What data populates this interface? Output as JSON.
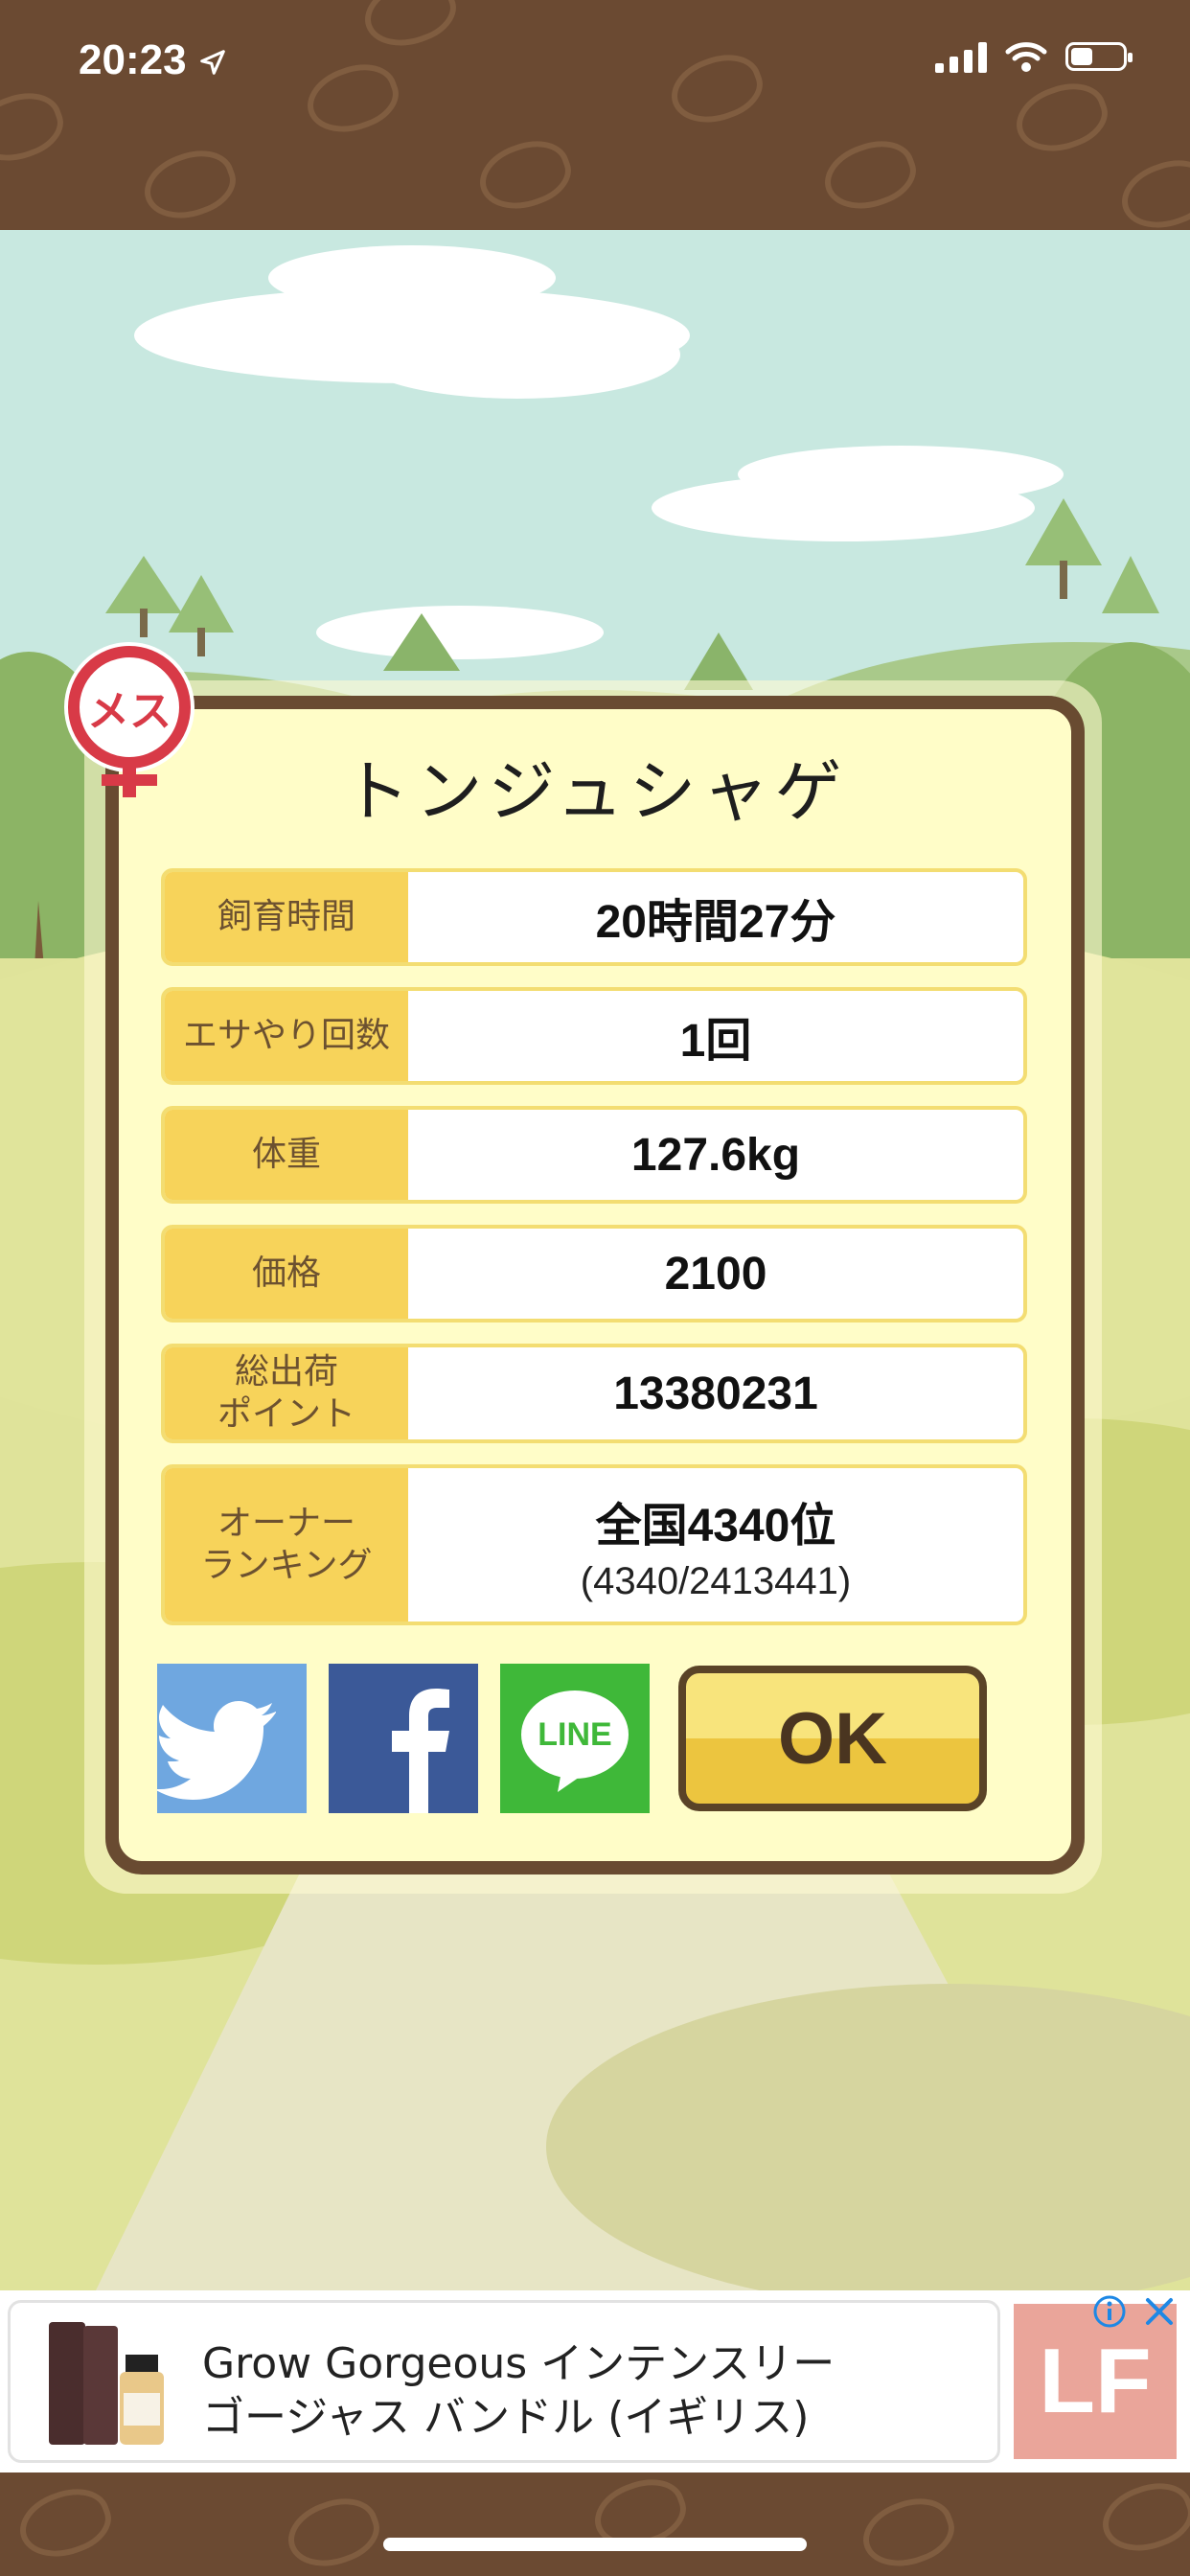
{
  "status_bar": {
    "time": "20:23",
    "icons": [
      "location-arrow-icon",
      "signal-icon",
      "wifi-icon",
      "battery-icon"
    ]
  },
  "gender_badge": {
    "text": "メス",
    "icon": "female-symbol-icon",
    "color": "#d83a47"
  },
  "pig": {
    "name": "トンジュシャゲ"
  },
  "stats": [
    {
      "label": "飼育時間",
      "value": "20時間27分"
    },
    {
      "label": "エサやり回数",
      "value": "1回"
    },
    {
      "label": "体重",
      "value": "127.6kg"
    },
    {
      "label": "価格",
      "value": "2100"
    },
    {
      "label_line1": "総出荷",
      "label_line2": "ポイント",
      "value": "13380231"
    },
    {
      "label_line1": "オーナー",
      "label_line2": "ランキング",
      "value": "全国4340位",
      "sub_value": "(4340/2413441)"
    }
  ],
  "share": {
    "twitter_icon": "twitter-bird-icon",
    "facebook_icon": "facebook-f-icon",
    "line_label": "LINE"
  },
  "ok_button": {
    "label": "OK"
  },
  "ad": {
    "line1": "Grow Gorgeous インテンスリー",
    "line2": "ゴージャス バンドル (イギリス)",
    "logo_text": "LF",
    "info_icon": "info-icon",
    "close_icon": "close-icon"
  },
  "colors": {
    "frame_brown": "#694b31",
    "panel_cream": "#fffdc8",
    "label_yellow": "#f7d35a",
    "twitter_blue": "#6fa7e0",
    "facebook_blue": "#3b5998",
    "line_green": "#3fb839",
    "ok_yellow": "#ecc53f"
  }
}
